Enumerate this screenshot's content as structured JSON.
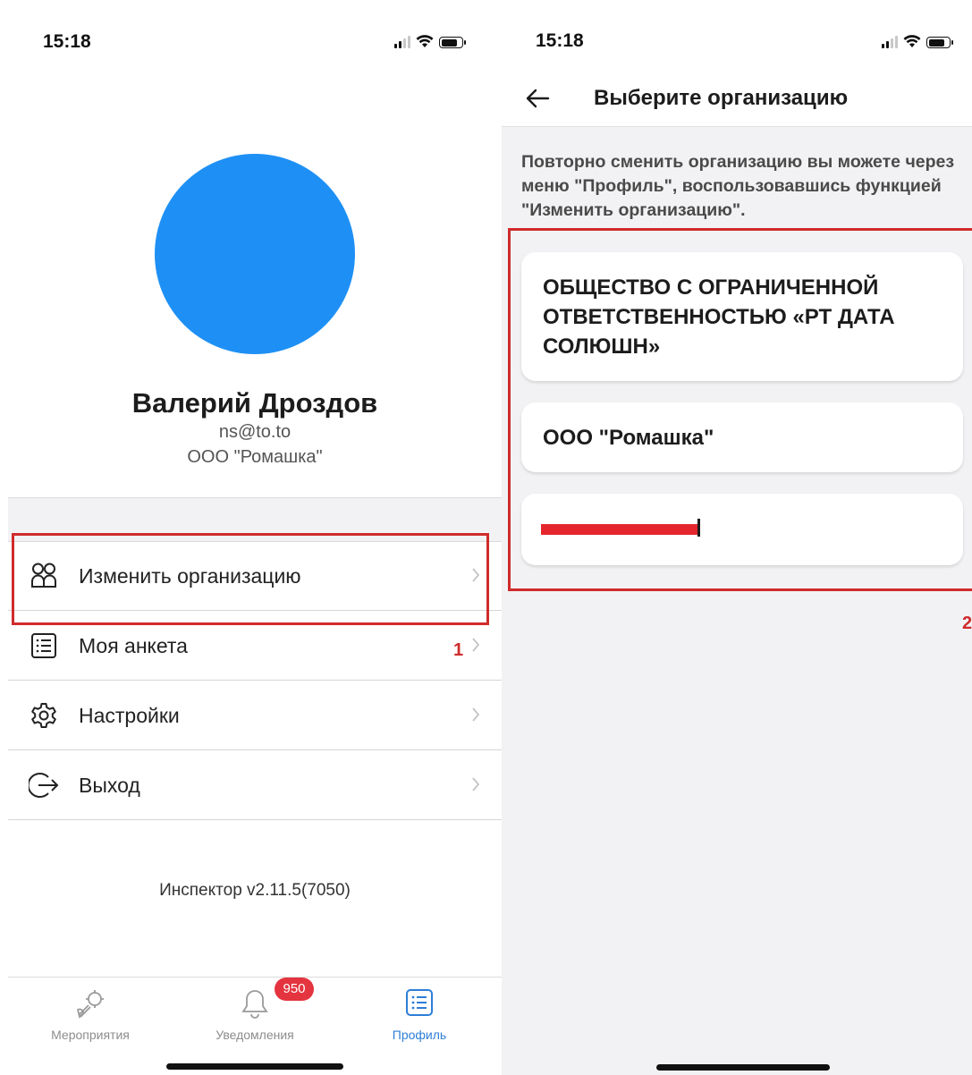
{
  "left_screen": {
    "status_bar": {
      "time": "15:18"
    },
    "profile": {
      "name": "Валерий Дроздов",
      "email": "ns@to.to",
      "organization": "ООО \"Ромашка\""
    },
    "menu": {
      "items": [
        {
          "label": "Изменить организацию",
          "icon": "people-icon"
        },
        {
          "label": "Моя анкета",
          "icon": "list-icon"
        },
        {
          "label": "Настройки",
          "icon": "gear-icon"
        },
        {
          "label": "Выход",
          "icon": "logout-icon"
        }
      ]
    },
    "annotation_1": "1",
    "version": "Инспектор v2.11.5(7050)",
    "tabbar": {
      "tabs": [
        {
          "label": "Мероприятия",
          "icon": "wrench-icon",
          "active": false
        },
        {
          "label": "Уведомления",
          "icon": "bell-icon",
          "active": false
        },
        {
          "label": "Профиль",
          "icon": "list-icon",
          "active": true
        }
      ],
      "notifications_badge": "950"
    }
  },
  "right_screen": {
    "status_bar": {
      "time": "15:18"
    },
    "header": {
      "title": "Выберите организацию"
    },
    "info_text": "Повторно сменить организацию вы можете через меню \"Профиль\", воспользовавшись функцией \"Изменить организацию\".",
    "organizations": [
      {
        "label": "ОБЩЕСТВО С ОГРАНИЧЕННОЙ ОТВЕТСТВЕННОСТЬЮ «РТ ДАТА СОЛЮШН»"
      },
      {
        "label": "ООО \"Ромашка\""
      },
      {
        "label": ""
      }
    ],
    "annotation_2": "2"
  },
  "colors": {
    "avatar": "#1e90f5",
    "accent": "#2d7ed6",
    "annotation": "#d02b2b",
    "badge": "#e4343f"
  }
}
